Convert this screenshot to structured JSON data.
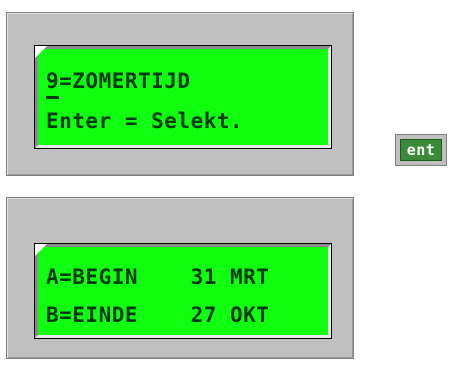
{
  "display_top": {
    "line1": "9=ZOMERTIJD",
    "line2": "Enter = Selekt."
  },
  "display_bottom": {
    "line1": "A=BEGIN    31 MRT",
    "line2": "B=EINDE    27 OKT"
  },
  "ent_button": {
    "label": "ent"
  },
  "colors": {
    "lcd_background": "#10ff10",
    "lcd_text": "#003a12",
    "panel": "#c0c0c0",
    "ent_button": "#3a8a3a"
  }
}
